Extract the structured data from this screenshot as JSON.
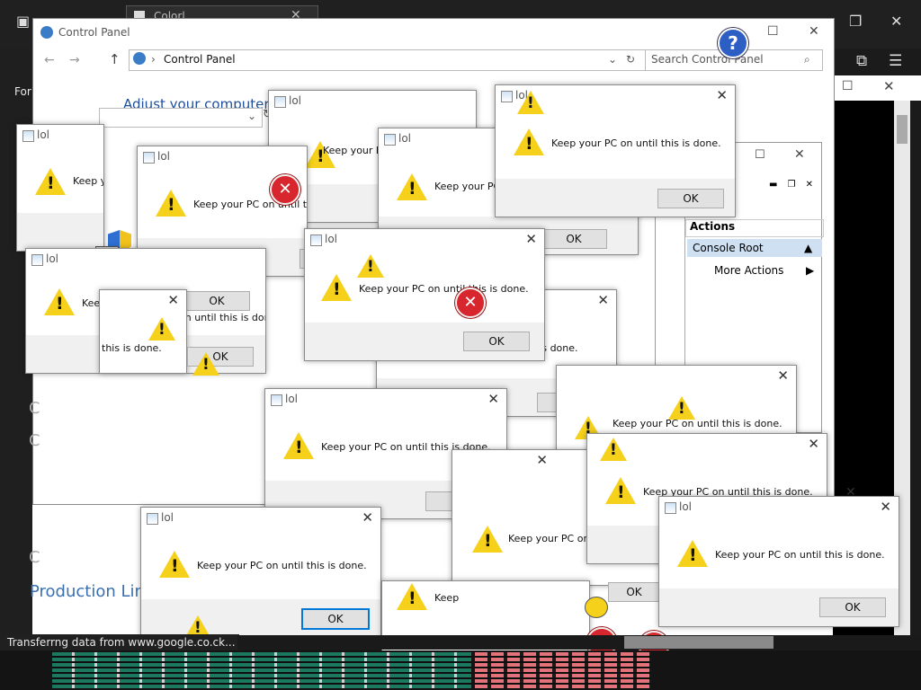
{
  "browser": {
    "tab_title": "Colorl",
    "for_link": "For",
    "status_text": "Transferrng data from www.google.co.ck...",
    "production_text": "Production Lin"
  },
  "control_panel": {
    "title": "Control Panel",
    "breadcrumb": "Control Panel",
    "search_placeholder": "Search Control Panel",
    "search_cut": "Se",
    "heading": "Adjust your computer's"
  },
  "mmc": {
    "actions_header": "Actions",
    "console_root": "Console Root",
    "more_actions": "More Actions",
    "name_fragment": "ame"
  },
  "dialog": {
    "title": "lol",
    "message": "Keep your PC on until this is done.",
    "ok_label": "OK",
    "fragments": {
      "keep_your_pc": "Keep your PC",
      "keep_y": "Keep y",
      "keep": "Keep",
      "keep_cut": "Keep",
      "until_this_is_done": "on until this is done.",
      "this_is_done": "this is done.",
      "is_done": "is is done.",
      "keep_on_until_th": "Keep your PC on until th",
      "s_is_done": "is is done.",
      "keep_your_pc_on": "Keep your PC on"
    }
  },
  "icons": {
    "warning": "#f5d11c",
    "error": "#d7262d",
    "help": "#2d5ec4"
  }
}
